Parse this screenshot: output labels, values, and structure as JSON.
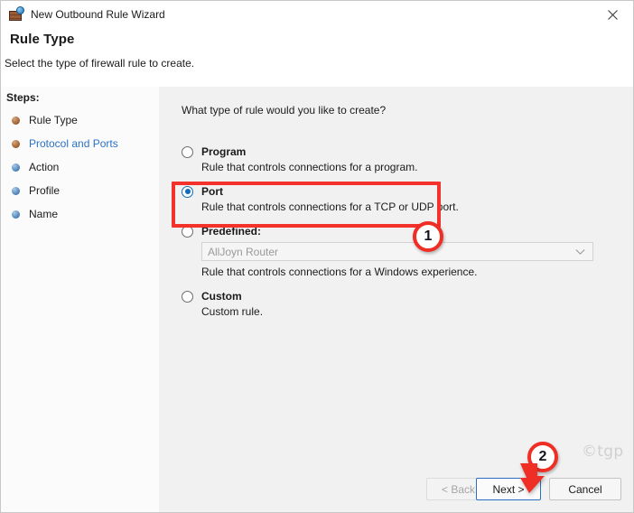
{
  "window": {
    "title": "New Outbound Rule Wizard",
    "icon": "firewall-globe-icon",
    "close_label": "✕"
  },
  "header": {
    "title": "Rule Type",
    "subtitle": "Select the type of firewall rule to create."
  },
  "sidebar": {
    "heading": "Steps:",
    "items": [
      {
        "label": "Rule Type",
        "bullet": "orange",
        "state": "completed"
      },
      {
        "label": "Protocol and Ports",
        "bullet": "orange",
        "state": "current-link"
      },
      {
        "label": "Action",
        "bullet": "blue",
        "state": "pending"
      },
      {
        "label": "Profile",
        "bullet": "blue",
        "state": "pending"
      },
      {
        "label": "Name",
        "bullet": "blue",
        "state": "pending"
      }
    ]
  },
  "main": {
    "question": "What type of rule would you like to create?",
    "options": [
      {
        "title": "Program",
        "description": "Rule that controls connections for a program.",
        "selected": false
      },
      {
        "title": "Port",
        "description": "Rule that controls connections for a TCP or UDP port.",
        "selected": true
      },
      {
        "title": "Predefined:",
        "description": "Rule that controls connections for a Windows experience.",
        "selected": false,
        "combo_value": "AllJoyn Router",
        "combo_arrow": "chevron-down-icon"
      },
      {
        "title": "Custom",
        "description": "Custom rule.",
        "selected": false
      }
    ]
  },
  "buttons": {
    "back": "< Back",
    "next": "Next >",
    "cancel": "Cancel"
  },
  "annotations": {
    "badge_1": "1",
    "badge_2": "2",
    "highlight_color": "#f4322c",
    "badge_color": "#ef2f26",
    "watermark": "©tgp"
  }
}
